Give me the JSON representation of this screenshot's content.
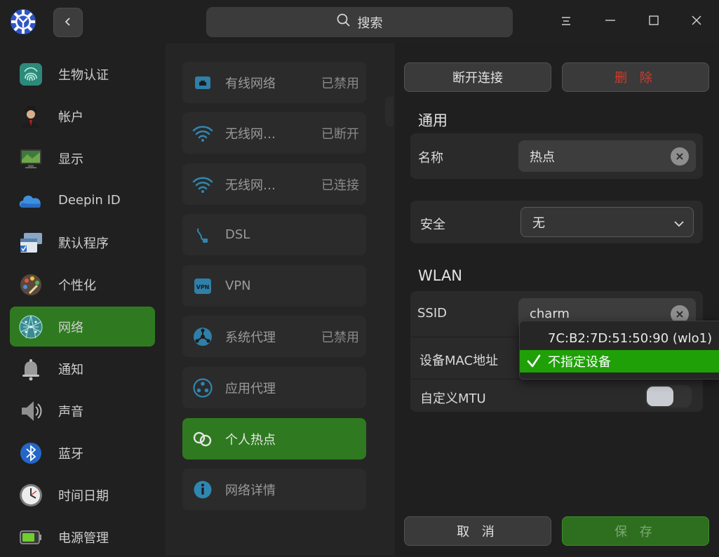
{
  "search": {
    "label": "搜索"
  },
  "sidebar": {
    "items": [
      {
        "label": "生物认证",
        "icon": "fingerprint-icon"
      },
      {
        "label": "帐户",
        "icon": "account-icon"
      },
      {
        "label": "显示",
        "icon": "display-icon"
      },
      {
        "label": "Deepin ID",
        "icon": "cloud-icon"
      },
      {
        "label": "默认程序",
        "icon": "default-apps-icon"
      },
      {
        "label": "个性化",
        "icon": "palette-icon"
      },
      {
        "label": "网络",
        "icon": "network-globe-icon",
        "active": true
      },
      {
        "label": "通知",
        "icon": "bell-icon"
      },
      {
        "label": "声音",
        "icon": "speaker-icon"
      },
      {
        "label": "蓝牙",
        "icon": "bluetooth-icon"
      },
      {
        "label": "时间日期",
        "icon": "clock-icon"
      },
      {
        "label": "电源管理",
        "icon": "battery-icon"
      }
    ]
  },
  "network_list": {
    "items": [
      {
        "label": "有线网络",
        "status": "已禁用",
        "icon": "wired-icon"
      },
      {
        "label": "无线网…",
        "status": "已断开",
        "icon": "wifi-icon"
      },
      {
        "label": "无线网…",
        "status": "已连接",
        "icon": "wifi-icon"
      },
      {
        "label": "DSL",
        "status": "",
        "icon": "dsl-icon"
      },
      {
        "label": "VPN",
        "status": "",
        "icon": "vpn-icon"
      },
      {
        "label": "系统代理",
        "status": "已禁用",
        "icon": "proxy-icon"
      },
      {
        "label": "应用代理",
        "status": "",
        "icon": "app-proxy-icon"
      },
      {
        "label": "个人热点",
        "status": "",
        "icon": "hotspot-icon",
        "active": true
      },
      {
        "label": "网络详情",
        "status": "",
        "icon": "info-icon"
      }
    ]
  },
  "panel": {
    "disconnect_label": "断开连接",
    "delete_label": "删 除",
    "general_title": "通用",
    "name_label": "名称",
    "name_value": "热点",
    "security_label": "安全",
    "security_value": "无",
    "wlan_title": "WLAN",
    "ssid_label": "SSID",
    "ssid_value": "charm",
    "mac_label": "设备MAC地址",
    "mtu_label": "自定义MTU",
    "mtu_enabled": false,
    "cancel_label": "取 消",
    "save_label": "保 存"
  },
  "mac_dropdown": {
    "options": [
      {
        "label": "7C:B2:7D:51:50:90 (wlo1)",
        "selected": false
      },
      {
        "label": "不指定设备",
        "selected": true
      }
    ]
  },
  "colors": {
    "accent": "#2f7a20",
    "selected_option": "#1fa007",
    "danger": "#d43a2a"
  }
}
